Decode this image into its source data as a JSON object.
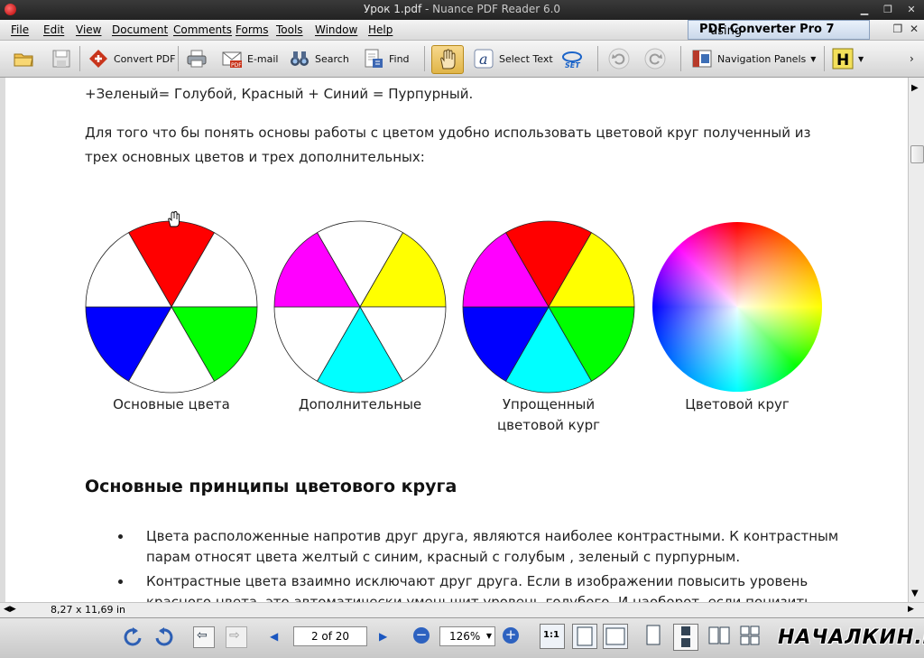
{
  "window": {
    "title": "Урок 1.pdf",
    "app_name": " - Nuance PDF Reader 6.0"
  },
  "menu": {
    "items": [
      "File",
      "Edit",
      "View",
      "Document",
      "Comments",
      "Forms",
      "Tools",
      "Window",
      "Help"
    ],
    "promo_prefix": "using ",
    "promo_product": "PDF Converter Pro 7"
  },
  "toolbar": {
    "convert_pdf": "Convert PDF",
    "email": "E-mail",
    "search": "Search",
    "find": "Find",
    "select_text": "Select Text",
    "navigation_panels": "Navigation Panels"
  },
  "document": {
    "line1": "+Зеленый= Голубой,  Красный + Синий = Пурпурный.",
    "para1_line1": "Для того что бы понять основы работы с цветом удобно использовать цветовой круг полученный из",
    "para1_line2": "трех основных цветов и трех дополнительных:",
    "wheels": [
      {
        "caption_line1": "Основные цвета",
        "caption_line2": ""
      },
      {
        "caption_line1": "Дополнительные",
        "caption_line2": ""
      },
      {
        "caption_line1": "Упрощенный",
        "caption_line2": "цветовой кург"
      },
      {
        "caption_line1": "Цветовой круг",
        "caption_line2": ""
      }
    ],
    "heading": "Основные принципы цветового круга",
    "bullets": [
      {
        "line1": "Цвета расположенные напротив друг друга, являются наиболее контрастными. К контрастным",
        "line2": "парам относят цвета желтый с синим, красный с голубым , зеленый с пурпурным."
      },
      {
        "line1": "Контрастные цвета взаимно исключают друг друга. Если в изображении повысить уровень",
        "line2": "красного цвета, это автоматически уменьшит уровень голубого. И наоборот, если понизить"
      }
    ]
  },
  "status": {
    "page_size": "8,27 x 11,69 in",
    "page_field": "2 of 20",
    "zoom_value": "126%"
  },
  "watermark": "НАЧАЛКИН.РУ",
  "colors": {
    "red": "#ff0000",
    "yellow": "#ffff00",
    "green": "#00ff00",
    "cyan": "#00ffff",
    "blue": "#0000ff",
    "magenta": "#ff00ff"
  }
}
